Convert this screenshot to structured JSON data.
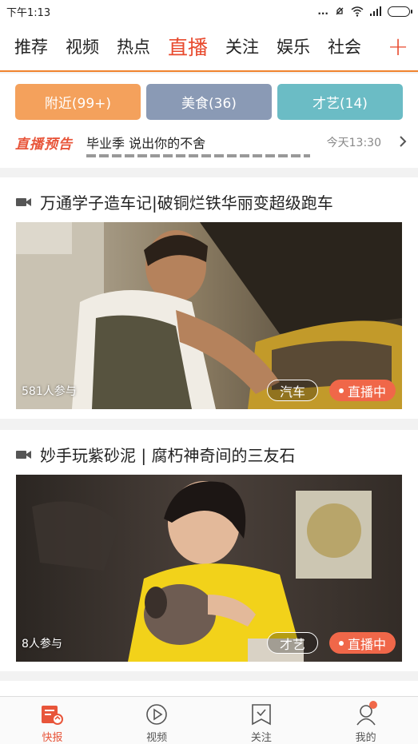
{
  "status_bar": {
    "time": "下午1:13",
    "dots": "..."
  },
  "channels": {
    "tabs": [
      "推荐",
      "视频",
      "热点",
      "直播",
      "关注",
      "娱乐",
      "社会"
    ],
    "active": "直播",
    "add_icon": "plus-icon"
  },
  "categories": {
    "buttons": [
      {
        "label": "附近(99+)",
        "color": "#f4a15c"
      },
      {
        "label": "美食(36)",
        "color": "#8a9ab5"
      },
      {
        "label": "才艺(14)",
        "color": "#6bbcc5"
      }
    ]
  },
  "preview": {
    "logo": "直播预告",
    "text": "毕业季 说出你的不舍",
    "time": "今天13:30",
    "arrow_icon": "chevron-right-icon"
  },
  "feed": [
    {
      "title": "万通学子造车记|破铜烂铁华丽变超级跑车",
      "participants": "581人参与",
      "tag": "汽车",
      "live_label": "直播中"
    },
    {
      "title": "妙手玩紫砂泥 | 腐朽神奇间的三友石",
      "participants": "8人参与",
      "tag": "才艺",
      "live_label": "直播中"
    }
  ],
  "bottom_nav": {
    "items": [
      {
        "label": "快报",
        "icon": "news-icon",
        "active": true
      },
      {
        "label": "视频",
        "icon": "play-icon",
        "active": false
      },
      {
        "label": "关注",
        "icon": "follow-icon",
        "active": false
      },
      {
        "label": "我的",
        "icon": "profile-icon",
        "active": false
      }
    ]
  },
  "colors": {
    "accent": "#e84a2e",
    "live": "#f06749"
  }
}
